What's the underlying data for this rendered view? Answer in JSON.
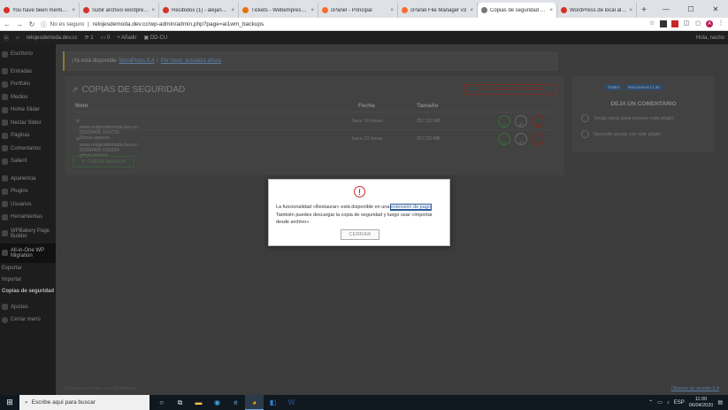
{
  "browser": {
    "tabs": [
      {
        "title": "You have been mentioned",
        "color": "#d93025"
      },
      {
        "title": "Subir archivo wordpress – N",
        "color": "#d93025"
      },
      {
        "title": "Recibidos (1) - alejandrabu",
        "color": "#d93025"
      },
      {
        "title": "Tickets - Webempresa Eur",
        "color": "#e8710a"
      },
      {
        "title": "cPanel - Principal",
        "color": "#ff6c2c"
      },
      {
        "title": "cPanel File Manager v3",
        "color": "#ff6c2c"
      },
      {
        "title": "Copias de seguridad ‹ — W",
        "color": "#555555"
      },
      {
        "title": "WordPress de local al Host",
        "color": "#d93025"
      }
    ],
    "tab_close": "×",
    "new_tab": "+",
    "window_controls": [
      "—",
      "☐",
      "✕"
    ],
    "insecure_label": "No es seguro",
    "url": "relojesdemoda.dev.cc/wp-admin/admin.php?page=ai1wm_backups",
    "profile_initial": "A"
  },
  "adminbar": {
    "site": "relojesdemoda.dev.cc",
    "updates": "1",
    "comments": "0",
    "new": "+ Añadir",
    "plugin": "DD-CU",
    "greeting": "Hola, nacho"
  },
  "sidebar": {
    "items": [
      "Escritorio",
      "Entradas",
      "Portfolio",
      "Medios",
      "Home Slider",
      "Nectar Slider",
      "Páginas",
      "Comentarios",
      "Salient",
      "Apariencia",
      "Plugins",
      "Usuarios",
      "Herramientas",
      "WPBakery Page Builder",
      "All-in-One WP Migration",
      "Exportar",
      "Importar",
      "Copias de seguridad",
      "Ajustes",
      "Cerrar menú"
    ]
  },
  "notice": {
    "text": "¡Ya está disponible",
    "link1": "WordPress 5.4",
    "link2": "Por favor, actualiza ahora",
    "end": "."
  },
  "backups": {
    "title": "COPIAS DE SEGURIDAD",
    "report_button": "INFORMA DE UN PROBLEMA",
    "columns": {
      "name": "Nom",
      "date": "Fecha",
      "size": "Tamaño"
    },
    "rows": [
      {
        "name": "www.relojesdemoda.dev.cc-20200405-154729-26ooo.wpress",
        "date": "hace 16 horas",
        "size": "257,33 MB"
      },
      {
        "name": "www.relojesdemoda.dev.cc-20200405-103234-gztyq.wpress",
        "date": "hace 21 horas",
        "size": "257,33 MB"
      }
    ],
    "create_button": "CREAR BACKUP"
  },
  "sidebox": {
    "twitter": "Twitter",
    "recommend": "Recommend 2.3K",
    "title": "DEJA UN COMENTARIO",
    "items": [
      "Tengo ideas para mejorar este plugin",
      "Necesito ayuda con este plugin"
    ]
  },
  "footer": {
    "left": "Gracias por crear con WordPress.",
    "version": "Obtener la versión 5.4"
  },
  "modal": {
    "icon": "!",
    "text_before": "La funcionalidad «Restaurar» está disponible en una ",
    "link": "extensión de pago",
    "text_after": ". También puedes descargar la copia de seguridad y luego usar «Importar desde archivo».",
    "close_button": "CERRAR"
  },
  "taskbar": {
    "search_placeholder": "Escribe aquí para buscar",
    "time": "11:00",
    "date": "06/04/2020",
    "lang": "ESP"
  }
}
